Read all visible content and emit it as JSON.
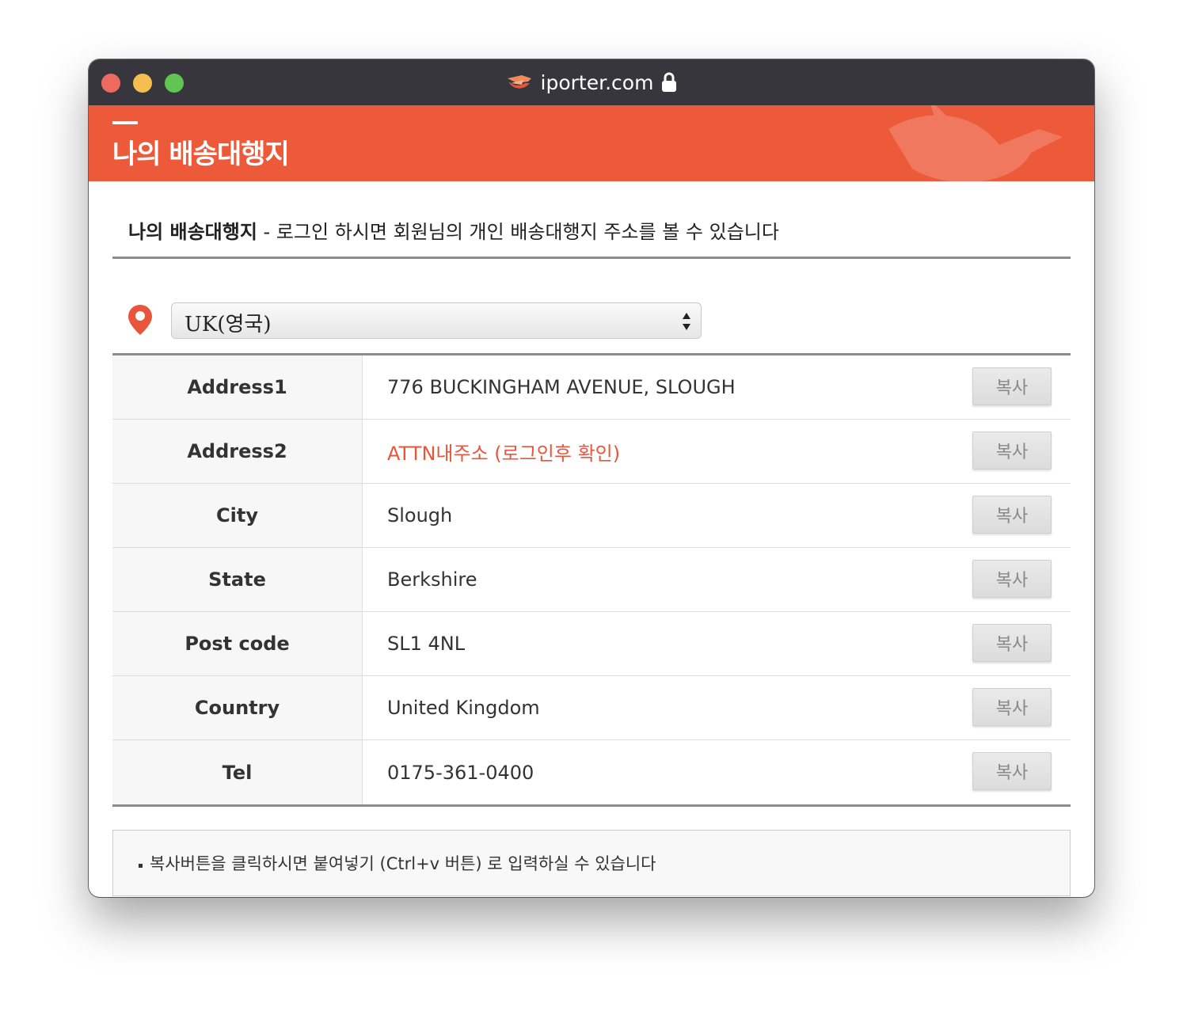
{
  "window": {
    "title": "iporter.com"
  },
  "banner": {
    "title": "나의 배송대행지"
  },
  "intro": {
    "strong": "나의 배송대행지",
    "text": " - 로그인 하시면 회원님의 개인 배송대행지 주소를 볼 수 있습니다"
  },
  "country_select": {
    "selected": "UK(영국)"
  },
  "address_rows": [
    {
      "label": "Address1",
      "value": "776 BUCKINGHAM AVENUE, SLOUGH",
      "button": "복사"
    },
    {
      "label": "Address2",
      "value": "ATTN내주소 (로그인후 확인)",
      "button": "복사"
    },
    {
      "label": "City",
      "value": "Slough",
      "button": "복사"
    },
    {
      "label": "State",
      "value": "Berkshire",
      "button": "복사"
    },
    {
      "label": "Post code",
      "value": "SL1 4NL",
      "button": "복사"
    },
    {
      "label": "Country",
      "value": "United Kingdom",
      "button": "복사"
    },
    {
      "label": "Tel",
      "value": "0175-361-0400",
      "button": "복사"
    }
  ],
  "note": {
    "text": "복사버튼을 클릭하시면 붙여넣기 (Ctrl+v 버튼) 로 입력하실 수 있습니다"
  },
  "colors": {
    "accent": "#ec5a3a",
    "highlight_text": "#e8553a",
    "titlebar": "#38363d"
  },
  "icons": {
    "site_logo": "bird-hand-icon",
    "lock": "lock-icon",
    "location": "map-pin-icon",
    "select_arrows": "up-down-arrows-icon"
  }
}
